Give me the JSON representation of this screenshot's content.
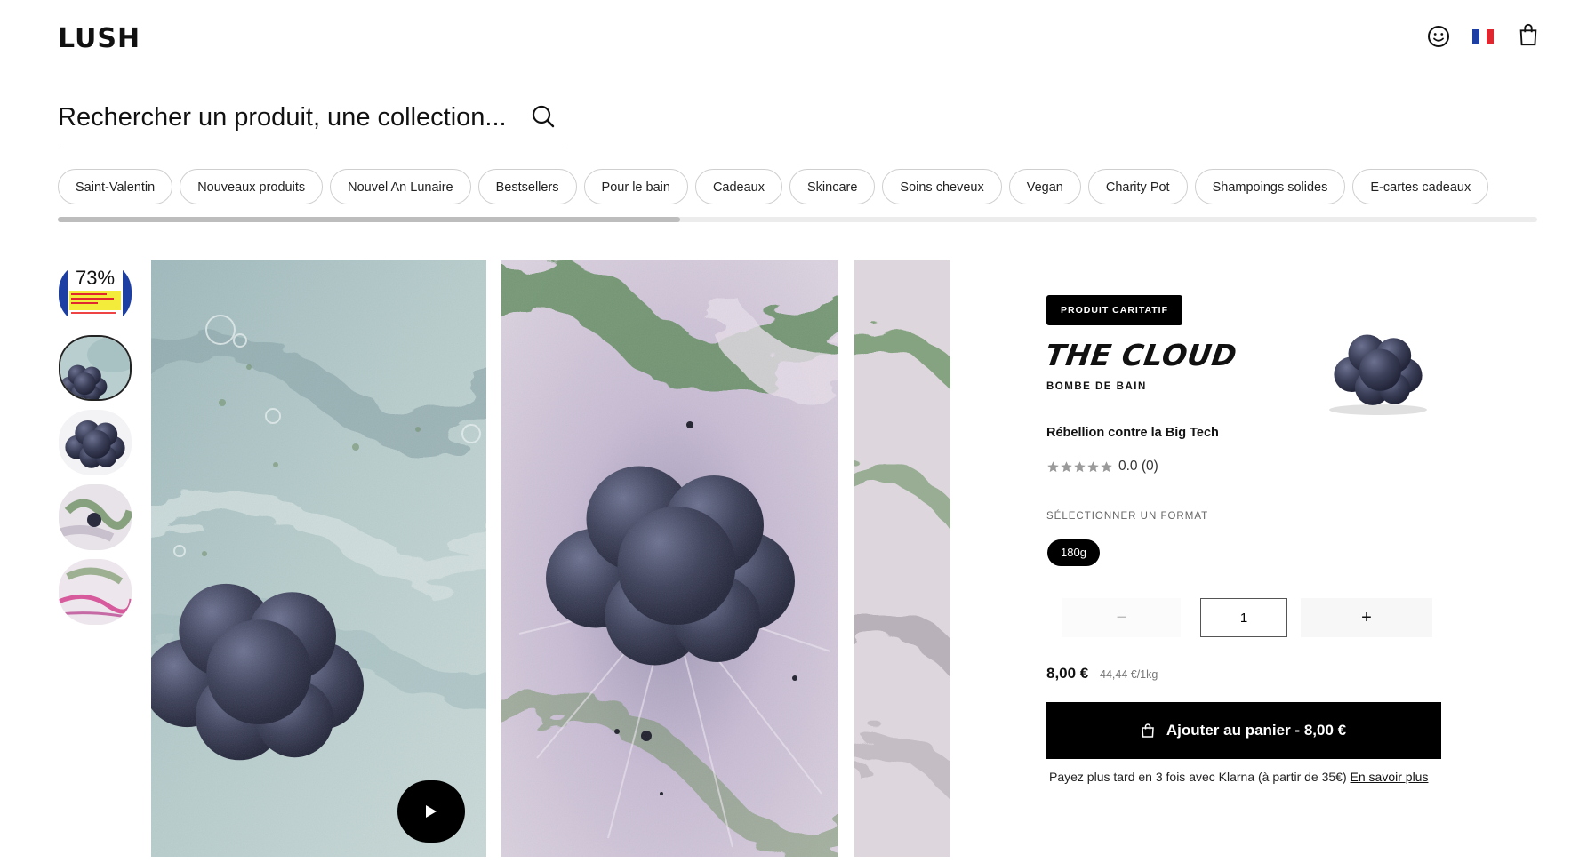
{
  "header": {
    "logo": "LUSH",
    "icons": [
      "account-icon",
      "france-flag-icon",
      "shopping-bag-icon"
    ]
  },
  "search": {
    "placeholder": "Rechercher un produit, une collection..."
  },
  "categories": [
    "Saint-Valentin",
    "Nouveaux produits",
    "Nouvel An Lunaire",
    "Bestsellers",
    "Pour le bain",
    "Cadeaux",
    "Skincare",
    "Soins cheveux",
    "Vegan",
    "Charity Pot",
    "Shampoings solides",
    "E-cartes cadeaux"
  ],
  "gallery": {
    "thumb_badge": "73%",
    "video_icon": "play-icon"
  },
  "product": {
    "badge": "PRODUIT CARITATIF",
    "name": "THE CLOUD",
    "type": "BOMBE DE BAIN",
    "tagline": "Rébellion contre la Big Tech",
    "rating_text": "0.0 (0)",
    "rating_value": 0,
    "rating_max": 5,
    "format_label": "SÉLECTIONNER UN FORMAT",
    "format_selected": "180g",
    "quantity": "1",
    "qty_minus": "−",
    "qty_plus": "+",
    "price": "8,00 €",
    "unit_price": "44,44 €/1kg",
    "add_to_cart": "Ajouter au panier - 8,00 €",
    "klarna_text": "Payez plus tard en 3 fois avec Klarna (à partir de 35€)",
    "klarna_link": "En savoir plus"
  },
  "colors": {
    "black": "#000000",
    "chip_border": "#cfcfcf",
    "bath_bomb": "#3b3f57"
  }
}
